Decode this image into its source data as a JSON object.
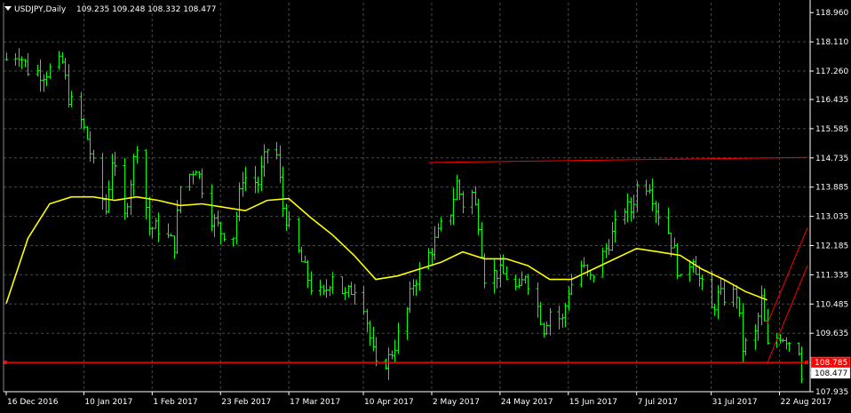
{
  "header": {
    "symbol_label": "USDJPY,Daily",
    "ohlc_text": "109.235 109.248 108.332 108.477"
  },
  "chart_data": {
    "type": "line",
    "chart_style": "bars",
    "title": "",
    "xlabel": "",
    "ylabel": "",
    "grid": true,
    "legend": "none",
    "ylim": [
      107.935,
      119.25
    ],
    "y_ticks": [
      "118.960",
      "118.110",
      "117.260",
      "116.435",
      "115.585",
      "114.735",
      "113.885",
      "113.035",
      "112.185",
      "111.335",
      "110.485",
      "109.635",
      "108.785",
      "108.477",
      "107.935"
    ],
    "x_ticks": [
      "16 Dec 2016",
      "10 Jan 2017",
      "1 Feb 2017",
      "23 Feb 2017",
      "17 Mar 2017",
      "10 Apr 2017",
      "2 May 2017",
      "24 May 2017",
      "15 Jun 2017",
      "7 Jul 2017",
      "31 Jul 2017",
      "22 Aug 2017"
    ],
    "x_range": [
      "2016-12-16",
      "2017-08-31"
    ],
    "close_price_path": [
      [
        "2016-12-16",
        117.6
      ],
      [
        "2016-12-20",
        117.8
      ],
      [
        "2016-12-23",
        117.3
      ],
      [
        "2016-12-28",
        117.2
      ],
      [
        "2017-01-03",
        117.5
      ],
      [
        "2017-01-05",
        116.5
      ],
      [
        "2017-01-09",
        115.8
      ],
      [
        "2017-01-11",
        115.3
      ],
      [
        "2017-01-13",
        114.5
      ],
      [
        "2017-01-17",
        113.2
      ],
      [
        "2017-01-19",
        114.7
      ],
      [
        "2017-01-23",
        113.0
      ],
      [
        "2017-01-27",
        115.2
      ],
      [
        "2017-01-31",
        112.7
      ],
      [
        "2017-02-03",
        112.7
      ],
      [
        "2017-02-08",
        112.2
      ],
      [
        "2017-02-10",
        113.9
      ],
      [
        "2017-02-15",
        114.5
      ],
      [
        "2017-02-20",
        113.0
      ],
      [
        "2017-02-23",
        112.6
      ],
      [
        "2017-02-27",
        112.5
      ],
      [
        "2017-03-02",
        114.2
      ],
      [
        "2017-03-07",
        114.0
      ],
      [
        "2017-03-10",
        115.0
      ],
      [
        "2017-03-13",
        114.8
      ],
      [
        "2017-03-15",
        113.3
      ],
      [
        "2017-03-17",
        112.7
      ],
      [
        "2017-03-21",
        111.7
      ],
      [
        "2017-03-24",
        111.0
      ],
      [
        "2017-03-28",
        110.7
      ],
      [
        "2017-03-31",
        111.4
      ],
      [
        "2017-04-04",
        110.7
      ],
      [
        "2017-04-07",
        111.0
      ],
      [
        "2017-04-10",
        110.5
      ],
      [
        "2017-04-12",
        109.5
      ],
      [
        "2017-04-14",
        108.6
      ],
      [
        "2017-04-18",
        108.9
      ],
      [
        "2017-04-20",
        109.3
      ],
      [
        "2017-04-24",
        110.3
      ],
      [
        "2017-04-26",
        111.1
      ],
      [
        "2017-04-28",
        111.4
      ],
      [
        "2017-05-02",
        112.1
      ],
      [
        "2017-05-05",
        112.7
      ],
      [
        "2017-05-08",
        113.2
      ],
      [
        "2017-05-10",
        114.0
      ],
      [
        "2017-05-12",
        113.4
      ],
      [
        "2017-05-15",
        113.7
      ],
      [
        "2017-05-17",
        112.9
      ],
      [
        "2017-05-19",
        111.3
      ],
      [
        "2017-05-23",
        111.4
      ],
      [
        "2017-05-26",
        111.3
      ],
      [
        "2017-05-30",
        110.8
      ],
      [
        "2017-06-01",
        111.4
      ],
      [
        "2017-06-05",
        110.4
      ],
      [
        "2017-06-07",
        109.8
      ],
      [
        "2017-06-09",
        110.3
      ],
      [
        "2017-06-13",
        110.0
      ],
      [
        "2017-06-15",
        110.9
      ],
      [
        "2017-06-19",
        111.6
      ],
      [
        "2017-06-22",
        111.2
      ],
      [
        "2017-06-26",
        111.9
      ],
      [
        "2017-06-28",
        112.3
      ],
      [
        "2017-07-03",
        113.3
      ],
      [
        "2017-07-05",
        113.2
      ],
      [
        "2017-07-07",
        113.9
      ],
      [
        "2017-07-11",
        114.0
      ],
      [
        "2017-07-13",
        113.3
      ],
      [
        "2017-07-17",
        112.6
      ],
      [
        "2017-07-19",
        112.0
      ],
      [
        "2017-07-21",
        111.1
      ],
      [
        "2017-07-25",
        111.9
      ],
      [
        "2017-07-27",
        111.2
      ],
      [
        "2017-07-31",
        110.3
      ],
      [
        "2017-08-02",
        110.7
      ],
      [
        "2017-08-04",
        110.7
      ],
      [
        "2017-08-08",
        110.8
      ],
      [
        "2017-08-10",
        109.2
      ],
      [
        "2017-08-14",
        109.6
      ],
      [
        "2017-08-16",
        110.6
      ],
      [
        "2017-08-18",
        109.2
      ],
      [
        "2017-08-22",
        109.6
      ],
      [
        "2017-08-24",
        109.5
      ],
      [
        "2017-08-28",
        109.2
      ],
      [
        "2017-08-29",
        108.5
      ]
    ],
    "moving_average": {
      "color": "#ffff00",
      "values": [
        [
          "2016-12-16",
          110.5
        ],
        [
          "2016-12-23",
          112.4
        ],
        [
          "2016-12-30",
          113.4
        ],
        [
          "2017-01-06",
          113.6
        ],
        [
          "2017-01-13",
          113.6
        ],
        [
          "2017-01-20",
          113.5
        ],
        [
          "2017-01-27",
          113.6
        ],
        [
          "2017-02-03",
          113.5
        ],
        [
          "2017-02-10",
          113.35
        ],
        [
          "2017-02-17",
          113.4
        ],
        [
          "2017-02-24",
          113.3
        ],
        [
          "2017-03-03",
          113.2
        ],
        [
          "2017-03-10",
          113.5
        ],
        [
          "2017-03-17",
          113.55
        ],
        [
          "2017-03-24",
          113.0
        ],
        [
          "2017-03-31",
          112.5
        ],
        [
          "2017-04-07",
          111.9
        ],
        [
          "2017-04-14",
          111.2
        ],
        [
          "2017-04-21",
          111.3
        ],
        [
          "2017-04-28",
          111.5
        ],
        [
          "2017-05-05",
          111.7
        ],
        [
          "2017-05-12",
          112.0
        ],
        [
          "2017-05-19",
          111.8
        ],
        [
          "2017-05-26",
          111.8
        ],
        [
          "2017-06-02",
          111.6
        ],
        [
          "2017-06-09",
          111.2
        ],
        [
          "2017-06-16",
          111.2
        ],
        [
          "2017-06-23",
          111.5
        ],
        [
          "2017-06-30",
          111.8
        ],
        [
          "2017-07-07",
          112.1
        ],
        [
          "2017-07-14",
          112.0
        ],
        [
          "2017-07-21",
          111.9
        ],
        [
          "2017-07-28",
          111.5
        ],
        [
          "2017-08-04",
          111.2
        ],
        [
          "2017-08-11",
          110.85
        ],
        [
          "2017-08-18",
          110.6
        ]
      ]
    },
    "lines": [
      {
        "name": "upper-resistance",
        "color": "#ff0000",
        "from": [
          "2017-05-01",
          114.6
        ],
        "to": [
          "2017-08-31",
          114.75
        ]
      },
      {
        "name": "horizontal-support",
        "color": "#ff0000",
        "from": [
          "2016-12-16",
          108.785
        ],
        "to": [
          "2017-08-31",
          108.785
        ]
      },
      {
        "name": "channel-upper",
        "color": "#ff0000",
        "from": [
          "2017-08-18",
          109.9
        ],
        "to": [
          "2017-08-31",
          112.7
        ]
      },
      {
        "name": "channel-lower",
        "color": "#ff0000",
        "from": [
          "2017-08-18",
          108.75
        ],
        "to": [
          "2017-08-31",
          111.6
        ]
      }
    ],
    "price_tags": [
      {
        "label": "108.785",
        "value": 108.785,
        "bg": "#ff0000",
        "fg": "#ffffff"
      },
      {
        "label": "108.477",
        "value": 108.477,
        "bg": "#ffffff",
        "fg": "#000000"
      }
    ],
    "colors": {
      "bar": "#00ff00",
      "grid": "#4a4a4a",
      "axis": "#ffffff",
      "background": "#000000"
    }
  }
}
